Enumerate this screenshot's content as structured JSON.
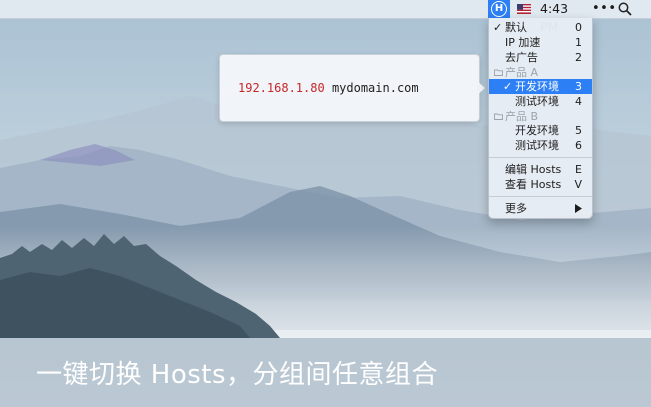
{
  "menubar": {
    "app_icon_letter": "H",
    "app_icon_name": "switchhosts-app-icon",
    "flag_icon_name": "us-flag-icon",
    "clock": "4:43 PM",
    "more_glyph": "•••",
    "search_icon_name": "search-icon",
    "accent_color": "#2d7ff5"
  },
  "popup": {
    "ip": "192.168.1.80",
    "domain": "mydomain.com"
  },
  "menu": {
    "items": [
      {
        "checked": true,
        "check_glyph": "✓",
        "label": "默认",
        "key": "0"
      },
      {
        "checked": false,
        "label": "IP 加速",
        "key": "1"
      },
      {
        "checked": false,
        "label": "去广告",
        "key": "2"
      }
    ],
    "group_a": {
      "label": "产品 A",
      "items": [
        {
          "checked": true,
          "check_glyph": "✓",
          "label": "开发环境",
          "key": "3",
          "highlighted": true
        },
        {
          "checked": false,
          "label": "测试环境",
          "key": "4"
        }
      ]
    },
    "group_b": {
      "label": "产品 B",
      "items": [
        {
          "checked": false,
          "label": "开发环境",
          "key": "5"
        },
        {
          "checked": false,
          "label": "测试环境",
          "key": "6"
        }
      ]
    },
    "edit_hosts": {
      "label": "编辑 Hosts",
      "key": "E"
    },
    "view_hosts": {
      "label": "查看 Hosts",
      "key": "V"
    },
    "more": {
      "label": "更多"
    }
  },
  "caption": "一键切换 Hosts，分组间任意组合"
}
